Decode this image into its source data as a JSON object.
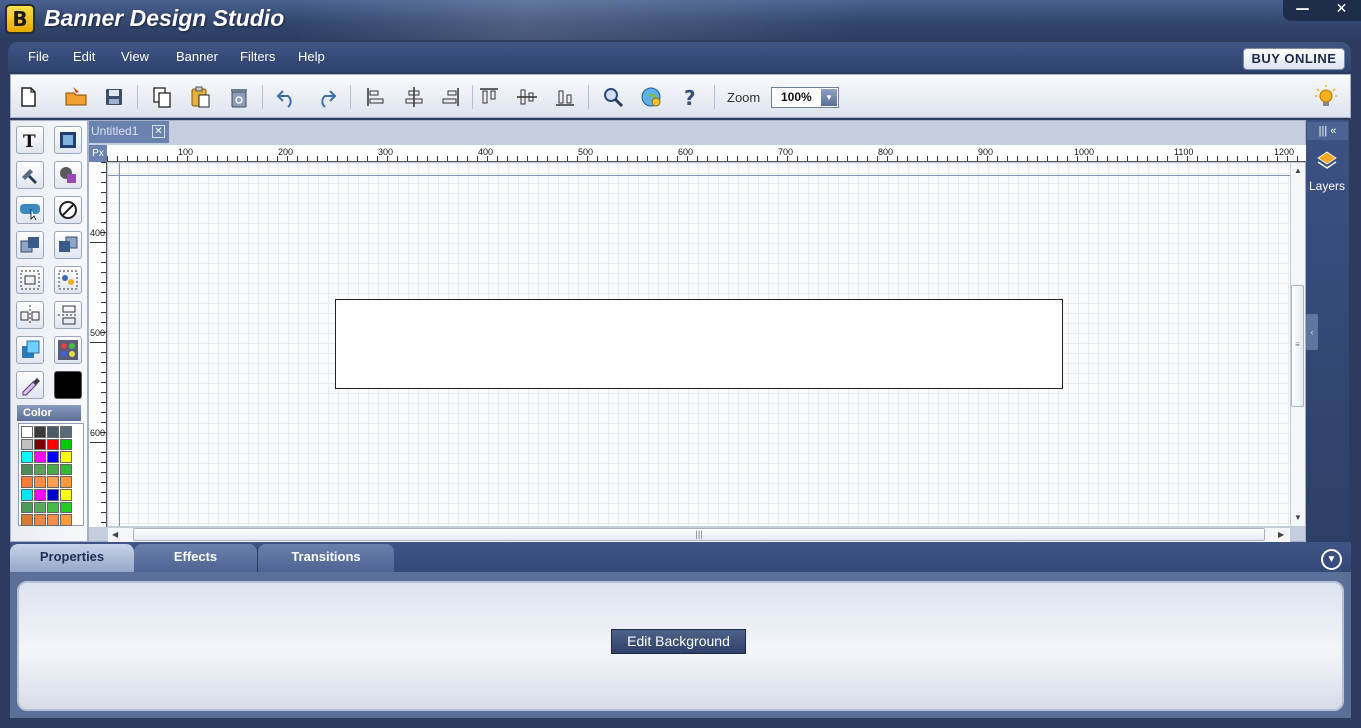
{
  "app": {
    "title": "Banner Design Studio",
    "logo_letter": "B"
  },
  "window_controls": {
    "minimize": "—",
    "close": "✕"
  },
  "menu": [
    "File",
    "Edit",
    "View",
    "Banner",
    "Filters",
    "Help"
  ],
  "buy_button": "BUY ONLINE",
  "toolbar": {
    "zoom_label": "Zoom",
    "zoom_value": "100%",
    "icons": [
      "new-file-icon",
      "open-folder-icon",
      "save-icon",
      "copy-icon",
      "paste-icon",
      "delete-icon",
      "undo-icon",
      "redo-icon",
      "align-left-icon",
      "align-center-icon",
      "align-right-icon",
      "align-top-icon",
      "align-middle-icon",
      "align-bottom-icon",
      "search-icon",
      "preview-globe-icon",
      "help-icon",
      "tip-bulb-icon"
    ]
  },
  "tools": [
    "text-tool-icon",
    "image-tool-icon",
    "clipart-tool-icon",
    "shape-tool-icon",
    "button-tool-icon",
    "ellipse-tool-icon",
    "bring-forward-icon",
    "send-backward-icon",
    "group-icon",
    "distribute-icon",
    "align-h-icon",
    "align-v-icon",
    "color-fill-icon",
    "effects-icon",
    "eyedropper-icon",
    "current-color-swatch"
  ],
  "color_panel": {
    "label": "Color",
    "current_color": "#000000",
    "swatches": [
      "#ffffff",
      "#3a3a3a",
      "#4a5a6a",
      "#5a6a7a",
      "#c0c0c0",
      "#7a0000",
      "#ff0000",
      "#00cc00",
      "#00ffff",
      "#ff00ff",
      "#0000ff",
      "#ffff00",
      "#4f8a5a",
      "#5aa05a",
      "#4aaa4a",
      "#33bb33",
      "#ff7a33",
      "#ff8c44",
      "#ffa050",
      "#ff9933",
      "#00e5ff",
      "#ff00ff",
      "#0000cc",
      "#ffff00",
      "#4c9a5a",
      "#58aa58",
      "#44bb44",
      "#22cc22",
      "#d97a33",
      "#e58844",
      "#ef9050",
      "#ff9a40"
    ]
  },
  "document": {
    "tab_label": "Untitled1",
    "ruler_unit": "Px"
  },
  "ruler": {
    "h_labels": [
      "100",
      "200",
      "300",
      "400",
      "500",
      "600",
      "700",
      "800",
      "900",
      "1000",
      "1100",
      "1200"
    ],
    "v_labels": [
      "400",
      "500",
      "600"
    ]
  },
  "layers": {
    "label": "Layers",
    "top_icon": "||| «"
  },
  "bottom_tabs": [
    "Properties",
    "Effects",
    "Transitions"
  ],
  "properties": {
    "edit_background_button": "Edit Background"
  }
}
